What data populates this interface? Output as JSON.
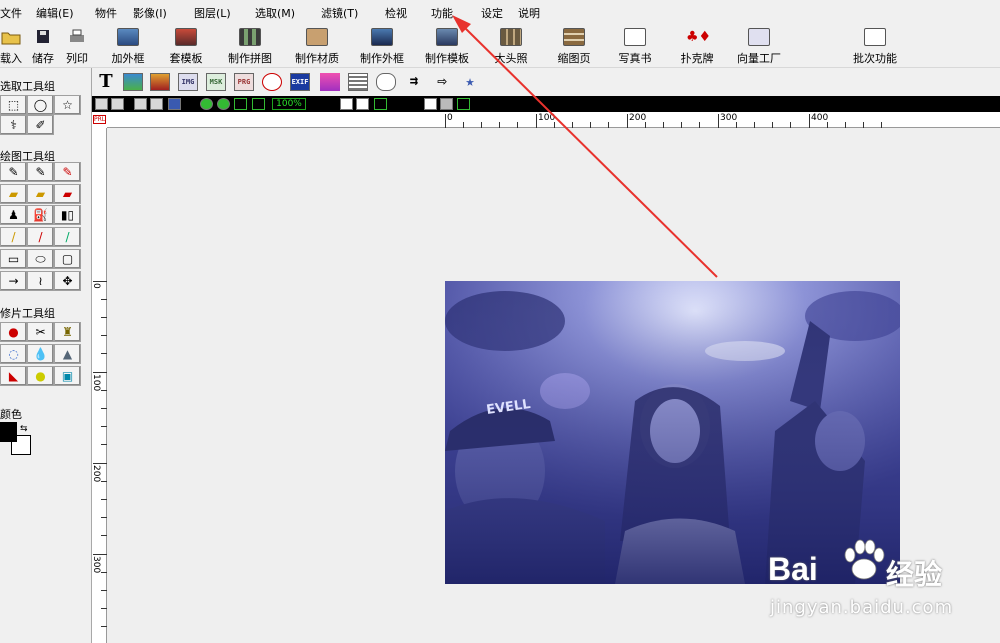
{
  "menu": [
    "文件",
    "编辑(E)",
    "物件",
    "影像(I)",
    "图层(L)",
    "选取(M)",
    "滤镜(T)",
    "检视",
    "功能",
    "设定",
    "说明"
  ],
  "toolbar": {
    "left_buttons": [
      {
        "label": "载入",
        "icon": "open-folder-icon"
      },
      {
        "label": "储存",
        "icon": "floppy-disk-icon"
      },
      {
        "label": "列印",
        "icon": "printer-icon"
      }
    ],
    "buttons": [
      {
        "label": "加外框",
        "icon": "frame-icon"
      },
      {
        "label": "套模板",
        "icon": "template-icon"
      },
      {
        "label": "制作拼图",
        "icon": "collage-icon"
      },
      {
        "label": "制作材质",
        "icon": "texture-icon"
      },
      {
        "label": "制作外框",
        "icon": "make-frame-icon"
      },
      {
        "label": "制作模板",
        "icon": "make-template-icon"
      },
      {
        "label": "大头照",
        "icon": "headshot-icon"
      },
      {
        "label": "缩图页",
        "icon": "thumbnail-page-icon"
      },
      {
        "label": "写真书",
        "icon": "photo-book-icon"
      },
      {
        "label": "扑克牌",
        "icon": "poker-card-icon"
      },
      {
        "label": "向量工厂",
        "icon": "vector-factory-icon"
      },
      {
        "label": "批次功能",
        "icon": "batch-icon"
      }
    ]
  },
  "toolbar2": {
    "text_tool": "T",
    "badges": [
      "IMG",
      "MSK",
      "PRG",
      "EXIF"
    ]
  },
  "blackbar": {
    "zoom": "100%"
  },
  "left_panel": {
    "select_group": "选取工具组",
    "draw_group": "绘图工具组",
    "retouch_group": "修片工具组",
    "color_label": "颜色"
  },
  "ruler": {
    "corner": "PRL",
    "top_labels": [
      "0",
      "100",
      "200",
      "300",
      "400"
    ],
    "left_labels": [
      "0",
      "100",
      "200",
      "300"
    ]
  },
  "watermark": {
    "brand": "Bai",
    "brand_cn": "经验",
    "url": "jingyan.baidu.com"
  },
  "photo": {
    "cap_text": "EVELL"
  },
  "colors": {
    "annotation_arrow": "#e8322d",
    "zoom_text": "#2be32b",
    "photo_tone": "#3a3f9a"
  }
}
